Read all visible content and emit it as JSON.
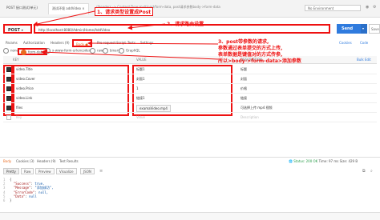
{
  "tabs": [
    {
      "label": "POST 接口测试(单元)",
      "active": false
    },
    {
      "label": "测试环境 addVideo",
      "active": true
    }
  ],
  "environment": "No Environment",
  "request": {
    "method": "POST",
    "url": "http://localhost:8080/Admin/Home/AddVideo",
    "send_label": "Send",
    "save_label": "Save",
    "curl_hint": "//headers -> Content-Type:multipart/form-data, post请求参数body->form-data"
  },
  "subtabs": {
    "params": "Params",
    "authorization": "Authorization",
    "headers": "Headers (9)",
    "body": "Body ●",
    "prerequest": "Pre-request Script",
    "tests": "Tests",
    "settings": "Settings",
    "cookies": "Cookies",
    "code": "Code"
  },
  "body_types": [
    {
      "label": "none",
      "selected": false
    },
    {
      "label": "form-data",
      "selected": true
    },
    {
      "label": "x-www-form-urlencoded",
      "selected": false
    },
    {
      "label": "raw",
      "selected": false
    },
    {
      "label": "binary",
      "selected": false
    },
    {
      "label": "GraphQL",
      "selected": false
    }
  ],
  "table": {
    "headers": [
      "KEY",
      "VALUE",
      "DESCRIPTION"
    ],
    "bulk_edit": "Bulk Edit",
    "rows": [
      {
        "key": "video.Title",
        "value": "标题1",
        "desc": "标题",
        "checked": true
      },
      {
        "key": "video.Cover",
        "value": "封面1",
        "desc": "封面",
        "checked": true
      },
      {
        "key": "video.Price",
        "value": "1",
        "desc": "价格",
        "checked": true
      },
      {
        "key": "video.Link",
        "value": "链接1",
        "desc": "链接",
        "checked": true
      },
      {
        "key": "files",
        "value": "examaVideo.mp4",
        "desc": "可选择上传 mp4 视频",
        "checked": true
      },
      {
        "key": "Key",
        "value": "Value",
        "desc": "Description",
        "checked": false
      }
    ]
  },
  "annotations": {
    "a1": "1、请求类型设置成Post",
    "a2": "2、请求路由设置",
    "a3_l1": "3、post带参数的请求,",
    "a3_l2": "参数通过表单提交的方式上传,",
    "a3_l3": "表单数据是键值对的方式传参,",
    "a3_l4": "所以>body->form-data>添加参数"
  },
  "response": {
    "tabs": [
      "Body",
      "Cookies (3)",
      "Headers (9)",
      "Test Results"
    ],
    "status": "Status: 200 OK",
    "time": "Time: 97 ms",
    "size": "Size: 429 B",
    "view_modes": [
      "Pretty",
      "Raw",
      "Preview",
      "Visualize"
    ],
    "format": "JSON",
    "lines": [
      {
        "n": "1",
        "text": "{"
      },
      {
        "n": "2",
        "key": "\"Success\"",
        "val": "true,"
      },
      {
        "n": "3",
        "key": "\"Message\"",
        "val": "\"添加成功\","
      },
      {
        "n": "4",
        "key": "\"ErrorCode\"",
        "val": "null,"
      },
      {
        "n": "5",
        "key": "\"Data\"",
        "val": "null"
      },
      {
        "n": "6",
        "text": "}"
      }
    ]
  },
  "colors": {
    "accent": "#e96b21",
    "send": "#2f7bde",
    "annotation": "#e11111"
  }
}
